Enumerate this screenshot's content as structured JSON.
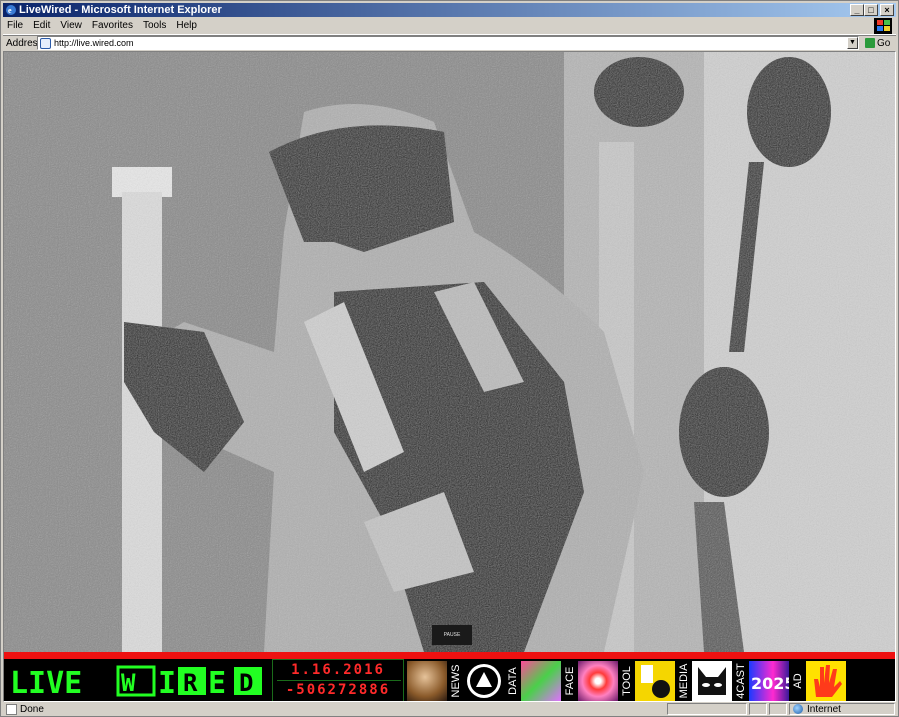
{
  "window": {
    "title": "LiveWired - Microsoft Internet Explorer",
    "controls": {
      "minimize": "_",
      "maximize": "□",
      "close": "×"
    }
  },
  "menu": {
    "items": [
      "File",
      "Edit",
      "View",
      "Favorites",
      "Tools",
      "Help"
    ]
  },
  "address": {
    "label": "Address",
    "url": "http://live.wired.com",
    "go_label": "Go"
  },
  "page": {
    "logo_text": "LIVEWIRED",
    "date": "1.16.2016",
    "counter": "-506272886",
    "pause_label": "PAUSE",
    "nav": [
      {
        "type": "thumb",
        "name": "face-thumb"
      },
      {
        "type": "label",
        "text": "NEWS"
      },
      {
        "type": "thumb",
        "name": "news-thumb"
      },
      {
        "type": "label",
        "text": "DATA"
      },
      {
        "type": "thumb",
        "name": "data-thumb"
      },
      {
        "type": "label",
        "text": "FACE"
      },
      {
        "type": "thumb",
        "name": "face2-thumb"
      },
      {
        "type": "label",
        "text": "TOOL"
      },
      {
        "type": "thumb",
        "name": "tool-thumb"
      },
      {
        "type": "label",
        "text": "MEDIA"
      },
      {
        "type": "thumb",
        "name": "media-thumb"
      },
      {
        "type": "label",
        "text": "4CAST"
      },
      {
        "type": "thumb",
        "name": "4cast-thumb"
      },
      {
        "type": "label",
        "text": "AD"
      },
      {
        "type": "thumb",
        "name": "ad-thumb"
      }
    ],
    "colors": {
      "red_bar": "#ee1111",
      "logo_green": "#22ff22",
      "counter_red": "#ff2a2a",
      "nav_bg": "#000000"
    }
  },
  "status": {
    "text": "Done",
    "progress": 0.0,
    "zone": "Internet"
  }
}
